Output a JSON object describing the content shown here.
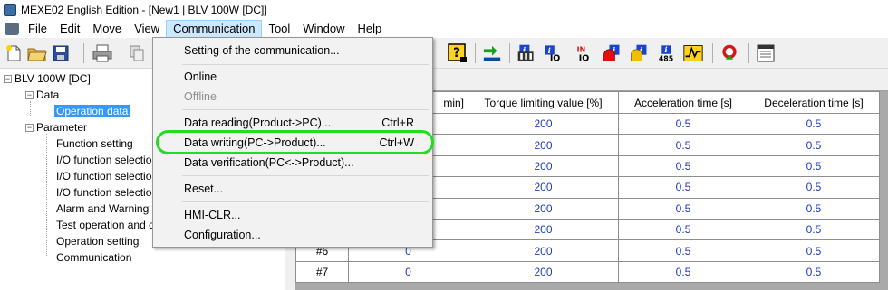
{
  "window": {
    "title": "MEXE02 English Edition - [New1 | BLV 100W [DC]]"
  },
  "menubar": {
    "items": [
      {
        "label": "File"
      },
      {
        "label": "Edit"
      },
      {
        "label": "Move"
      },
      {
        "label": "View"
      },
      {
        "label": "Communication"
      },
      {
        "label": "Tool"
      },
      {
        "label": "Window"
      },
      {
        "label": "Help"
      }
    ],
    "active": "Communication"
  },
  "toolbar": {
    "icons": [
      "new-icon",
      "open-folder-icon",
      "save-icon",
      "print-icon",
      "copy-icon",
      "help-icon",
      "data-transfer-icon",
      "info-icon",
      "info-io-icon",
      "info-in-icon",
      "alarm-icon",
      "warning-icon",
      "info-485-icon",
      "waveform-icon",
      "teaching-icon",
      "window-icon"
    ],
    "labels": {
      "io": "IO",
      "in": "IN",
      "num485": "485",
      "help": "?"
    }
  },
  "tree": {
    "root": "BLV 100W [DC]",
    "groups": [
      {
        "label": "Data",
        "children": [
          "Operation data"
        ]
      },
      {
        "label": "Parameter",
        "children": [
          "Function setting",
          "I/O function selection[",
          "I/O function selection[",
          "I/O function selection[",
          "Alarm and Warning",
          "Test operation and disp",
          "Operation setting",
          "Communication"
        ]
      }
    ],
    "selected": "Operation data"
  },
  "dropdown": {
    "items": [
      {
        "label": "Setting of the communication...",
        "shortcut": "",
        "enabled": true
      },
      {
        "label": "Online",
        "shortcut": "",
        "enabled": true
      },
      {
        "label": "Offline",
        "shortcut": "",
        "enabled": false
      },
      {
        "label": "Data reading(Product->PC)...",
        "shortcut": "Ctrl+R",
        "enabled": true
      },
      {
        "label": "Data writing(PC->Product)...",
        "shortcut": "Ctrl+W",
        "enabled": true,
        "highlighted": true
      },
      {
        "label": "Data verification(PC<->Product)...",
        "shortcut": "",
        "enabled": true
      },
      {
        "label": "Reset...",
        "shortcut": "",
        "enabled": true
      },
      {
        "label": "HMI-CLR...",
        "shortcut": "",
        "enabled": true
      },
      {
        "label": "Configuration...",
        "shortcut": "",
        "enabled": true
      }
    ],
    "highlight_color": "#22dd22"
  },
  "grid": {
    "columns": [
      "min]",
      "Torque limiting value [%]",
      "Acceleration time [s]",
      "Deceleration time [s]"
    ],
    "rows": [
      {
        "no": "",
        "speed": "",
        "torque": "200",
        "accel": "0.5",
        "decel": "0.5"
      },
      {
        "no": "",
        "speed": "",
        "torque": "200",
        "accel": "0.5",
        "decel": "0.5"
      },
      {
        "no": "",
        "speed": "",
        "torque": "200",
        "accel": "0.5",
        "decel": "0.5"
      },
      {
        "no": "",
        "speed": "",
        "torque": "200",
        "accel": "0.5",
        "decel": "0.5"
      },
      {
        "no": "",
        "speed": "",
        "torque": "200",
        "accel": "0.5",
        "decel": "0.5"
      },
      {
        "no": "",
        "speed": "",
        "torque": "200",
        "accel": "0.5",
        "decel": "0.5"
      },
      {
        "no": "#6",
        "speed": "0",
        "torque": "200",
        "accel": "0.5",
        "decel": "0.5"
      },
      {
        "no": "#7",
        "speed": "0",
        "torque": "200",
        "accel": "0.5",
        "decel": "0.5"
      }
    ],
    "value_color": "#1e3cbd"
  }
}
